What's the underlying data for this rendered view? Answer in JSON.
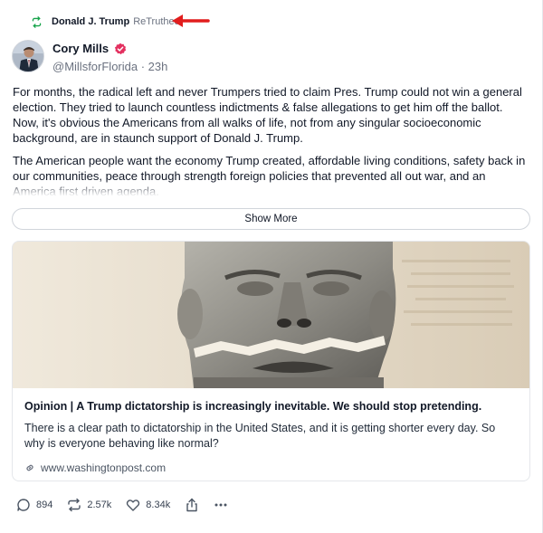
{
  "retruth": {
    "user_name": "Donald J. Trump",
    "label": "ReTruthed",
    "icon": "retruth-icon",
    "arrow_color": "#e11d1d"
  },
  "author": {
    "name": "Cory Mills",
    "handle_time": "@MillsforFlorida · 23h",
    "verified_icon": "verified-badge-icon",
    "verified_color": "#e3305f"
  },
  "post": {
    "paragraphs": [
      "For months, the radical left and never Trumpers tried to claim Pres. Trump could not win a general election. They tried to launch countless indictments & false allegations to get him off the ballot. Now, it's obvious the Americans from all walks of life, not from any singular socioeconomic background, are in staunch support of Donald J. Trump.",
      "The American people want the economy Trump created, affordable living conditions, safety back in our communities, peace through strength foreign policies that prevented all out war, and an America first driven agenda."
    ],
    "show_more_label": "Show More"
  },
  "card": {
    "title": "Opinion | A Trump dictatorship is increasingly inevitable. We should stop pretending.",
    "description": "There is a clear path to dictatorship in the United States, and it is getting shorter every day. So why is everyone behaving like normal?",
    "domain": "www.washingtonpost.com",
    "image_icon": "torn-statue-image"
  },
  "actions": {
    "replies": "894",
    "retruths": "2.57k",
    "likes": "8.34k",
    "share_icon": "share-icon",
    "more_icon": "more-icon"
  }
}
